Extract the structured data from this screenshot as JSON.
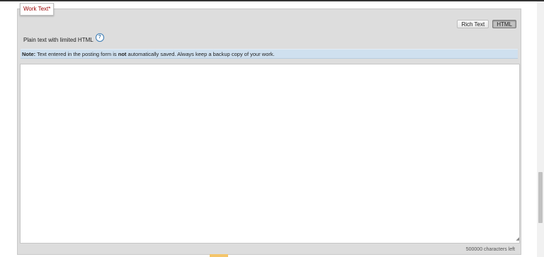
{
  "fieldset": {
    "legend": "Work Text",
    "required_marker": "*"
  },
  "editor_toggle": {
    "rich_text_label": "Rich Text",
    "html_label": "HTML",
    "active": "HTML"
  },
  "format_info": {
    "text": "Plain text with limited HTML",
    "help_glyph": "?"
  },
  "notice": {
    "label": "Note:",
    "text_before": " Text entered in the posting form is ",
    "emphasis": "not",
    "text_after": " automatically saved. Always keep a backup copy of your work."
  },
  "work_text": {
    "value": "",
    "resize_glyph": "◢"
  },
  "character_counter": {
    "text": "500000 characters left"
  },
  "colors": {
    "legend_text": "#990000",
    "fieldset_bg": "#dddddd",
    "notice_bg": "#cfe0ef",
    "help_icon": "#2a6aa3"
  },
  "icons": {
    "help": "help-icon",
    "resize": "resize-handle-icon"
  }
}
